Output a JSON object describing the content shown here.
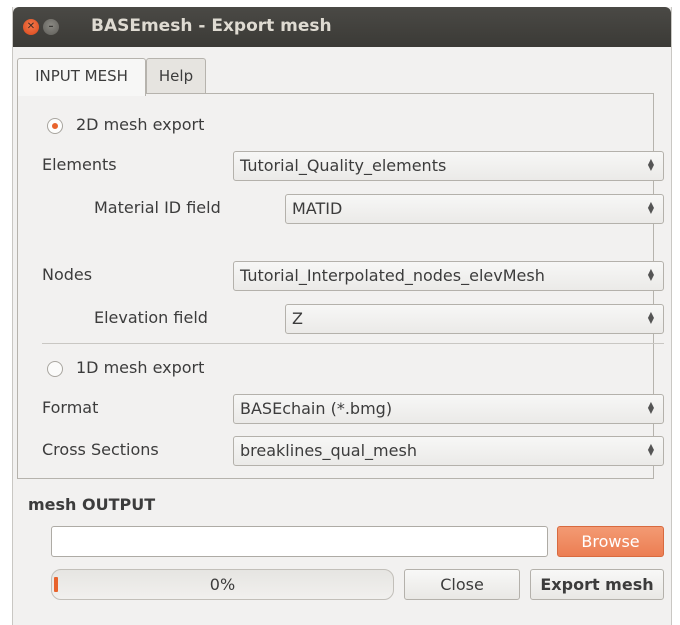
{
  "window": {
    "title": "BASEmesh - Export mesh"
  },
  "tabs": [
    {
      "label": "INPUT MESH",
      "active": true
    },
    {
      "label": "Help",
      "active": false
    }
  ],
  "mesh2d": {
    "radio_label": "2D mesh export",
    "selected": true,
    "elements_label": "Elements",
    "elements_value": "Tutorial_Quality_elements",
    "material_label": "Material ID field",
    "material_value": "MATID",
    "nodes_label": "Nodes",
    "nodes_value": "Tutorial_Interpolated_nodes_elevMesh",
    "elevation_label": "Elevation field",
    "elevation_value": "Z"
  },
  "mesh1d": {
    "radio_label": "1D mesh export",
    "selected": false,
    "format_label": "Format",
    "format_value": "BASEchain (*.bmg)",
    "cross_label": "Cross Sections",
    "cross_value": "breaklines_qual_mesh"
  },
  "output": {
    "section_title": "mesh OUTPUT",
    "path_value": "",
    "browse_label": "Browse",
    "progress_text": "0%",
    "progress_fraction": 0.0,
    "close_label": "Close",
    "export_label": "Export mesh"
  },
  "colors": {
    "accent": "#e8632c",
    "titlebar": "#3c3b37"
  },
  "icons": {
    "close": "close-icon",
    "minimize": "minimize-icon",
    "combo_arrows": "up-down-arrows-icon"
  }
}
